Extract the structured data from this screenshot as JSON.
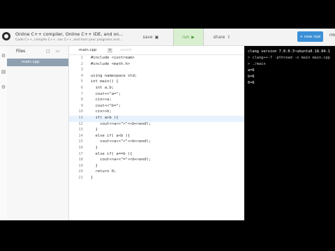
{
  "header": {
    "title": "Online C++ compiler, Online C++ IDE, and on...",
    "subtitle": "Code C++, compile C++, run C++, and host your programs and...",
    "save_label": "save",
    "run_label": "run",
    "share_label": "share",
    "new_repl_label": "+ new repl",
    "avatar_text": "rm"
  },
  "files": {
    "title": "Files",
    "selected_file": "main.cpp"
  },
  "editor": {
    "tab_name": "main.cpp",
    "tab_other": "saved",
    "lines": [
      {
        "no": "1",
        "text": "#include <iostream>"
      },
      {
        "no": "2",
        "text": "#include <math.h>"
      },
      {
        "no": "3",
        "text": ""
      },
      {
        "no": "4",
        "text": "using namespace std;"
      },
      {
        "no": "5",
        "text": "int main() {"
      },
      {
        "no": "6",
        "text": "  int a,b;"
      },
      {
        "no": "7",
        "text": "  cout<<\"a=\";"
      },
      {
        "no": "8",
        "text": "  cin>>a;"
      },
      {
        "no": "9",
        "text": "  cout<<\"b=\";"
      },
      {
        "no": "10",
        "text": "  cin>>b;"
      },
      {
        "no": "11",
        "text": "  if( a>b ){"
      },
      {
        "no": "12",
        "text": "    cout<<a<<\">\"<<b<<endl;"
      },
      {
        "no": "13",
        "text": "  }"
      },
      {
        "no": "14",
        "text": "  else if( a<b ){"
      },
      {
        "no": "15",
        "text": "    cout<<a<<\"<\"<<b<<endl;"
      },
      {
        "no": "16",
        "text": "  }"
      },
      {
        "no": "17",
        "text": "  else if( a==b ){"
      },
      {
        "no": "18",
        "text": "    cout<<a<<\"=\"<<b<<endl;"
      },
      {
        "no": "19",
        "text": "  }"
      },
      {
        "no": "20",
        "text": "  return 0;"
      },
      {
        "no": "21",
        "text": "}"
      }
    ]
  },
  "console": {
    "lines": [
      "clang version 7.0.0-3~ubuntu0.18.04.1",
      "> clang++-7 -pthread -o main main.cpp",
      "> ./main",
      "a=6",
      "b=6",
      "6=6"
    ]
  }
}
